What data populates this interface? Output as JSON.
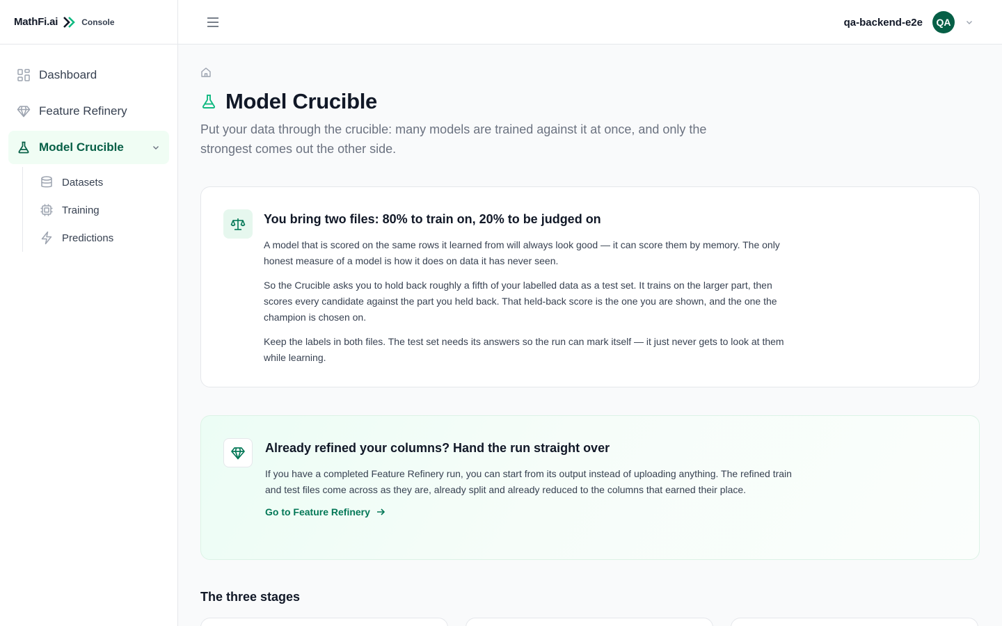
{
  "brand": {
    "name": "MathFi.ai",
    "product": "Console"
  },
  "sidebar": {
    "items": [
      {
        "label": "Dashboard",
        "icon": "dashboard-icon"
      },
      {
        "label": "Feature Refinery",
        "icon": "gem-icon"
      },
      {
        "label": "Model Crucible",
        "icon": "flask-icon",
        "active": true
      }
    ],
    "subitems": [
      {
        "label": "Datasets",
        "icon": "database-icon"
      },
      {
        "label": "Training",
        "icon": "cpu-icon"
      },
      {
        "label": "Predictions",
        "icon": "lightning-icon"
      }
    ]
  },
  "header": {
    "username": "qa-backend-e2e",
    "avatar_initials": "QA"
  },
  "page": {
    "title": "Model Crucible",
    "subtitle": "Put your data through the crucible: many models are trained against it at once, and only the strongest comes out the other side."
  },
  "card1": {
    "title": "You bring two files: 80% to train on, 20% to be judged on",
    "p1": "A model that is scored on the same rows it learned from will always look good — it can score them by memory. The only honest measure of a model is how it does on data it has never seen.",
    "p2": "So the Crucible asks you to hold back roughly a fifth of your labelled data as a test set. It trains on the larger part, then scores every candidate against the part you held back. That held-back score is the one you are shown, and the one the champion is chosen on.",
    "p3": "Keep the labels in both files. The test set needs its answers so the run can mark itself — it just never gets to look at them while learning."
  },
  "card2": {
    "title": "Already refined your columns? Hand the run straight over",
    "p1": "If you have a completed Feature Refinery run, you can start from its output instead of uploading anything. The refined train and test files come across as they are, already split and already reduced to the columns that earned their place.",
    "link": "Go to Feature Refinery"
  },
  "stages": {
    "title": "The three stages"
  },
  "colors": {
    "accent": "#065f46",
    "accent_light": "#f0fdf4",
    "link": "#047857"
  }
}
